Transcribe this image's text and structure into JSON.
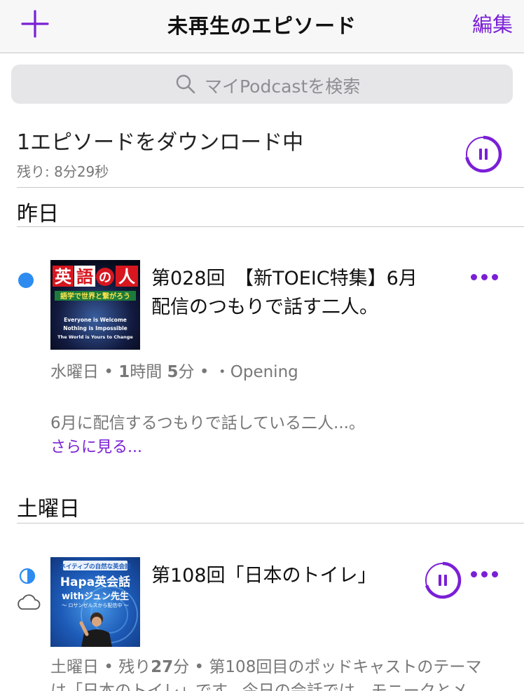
{
  "nav": {
    "title": "未再生のエピソード",
    "edit_label": "編集",
    "add_icon": "plus-icon"
  },
  "search": {
    "placeholder": "マイPodcastを検索",
    "icon": "search-icon"
  },
  "download": {
    "title": "1エピソードをダウンロード中",
    "remaining": "残り: 8分29秒",
    "progress": 0.72
  },
  "sections": [
    {
      "heading": "昨日",
      "episode": {
        "status": "unplayed",
        "artwork": {
          "title_kanji_1": "英",
          "title_kanji_2": "語",
          "title_no": "の",
          "title_kanji_3": "人",
          "subtitle": "語学で世界と繋がろう",
          "line1": "Everyone is Welcome",
          "line2": "Nothing is Impossible",
          "line3": "The World is Yours to Change"
        },
        "title": "第028回　【新TOEIC特集】6月配信のつもりで話す二人。",
        "meta_day": "水曜日",
        "meta_duration_h": "1",
        "meta_duration_h_unit": "時間",
        "meta_duration_m": "5",
        "meta_duration_m_unit": "分",
        "meta_extra": "・Opening",
        "description": "6月に配信するつもりで話している二人...。",
        "more_label": "さらに見る..."
      }
    },
    {
      "heading": "土曜日",
      "episode": {
        "status": "partially-played",
        "artwork": {
          "top_banner": "ネイティブの自然な英会話",
          "title_1": "Hapa英会話",
          "title_2": "withジュン先生",
          "subtitle": "〜 ロサンゼルスから配信中 〜"
        },
        "title": "第108回「日本のトイレ」",
        "meta_day": "土曜日",
        "meta_remaining_prefix": "残り",
        "meta_remaining_value": "27",
        "meta_remaining_unit": "分",
        "meta_desc": "第108回目のポッドキャストのテーマ",
        "meta_desc_line2": "は「日本のトイレ」です。今日の会話では、モニークとメ",
        "play_progress": 0.7
      }
    }
  ],
  "colors": {
    "accent": "#7a1fd6",
    "unplayed_dot": "#2e8cf0",
    "secondary_text": "#777777",
    "divider": "#c8c8cc"
  }
}
